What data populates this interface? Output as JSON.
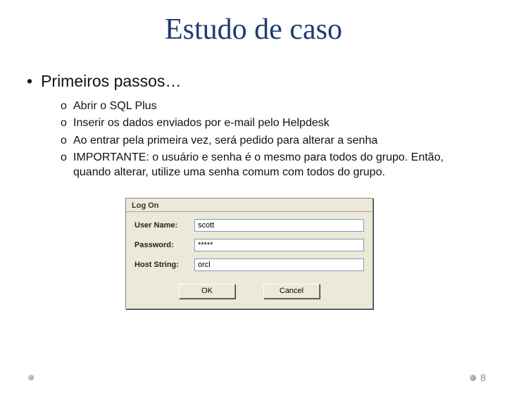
{
  "title": "Estudo de caso",
  "heading": "Primeiros passos…",
  "items": [
    "Abrir o SQL Plus",
    "Inserir os dados enviados por e-mail pelo Helpdesk",
    "Ao entrar pela primeira vez, será pedido para alterar a senha",
    "IMPORTANTE: o usuário e senha é o mesmo para todos do grupo. Então, quando alterar, utilize uma senha comum com todos do grupo."
  ],
  "dialog": {
    "title": "Log On",
    "username_label": "User Name:",
    "username_value": "scott",
    "password_label": "Password:",
    "password_value": "*****",
    "host_label": "Host String:",
    "host_value": "orcl",
    "ok_label": "OK",
    "cancel_label": "Cancel"
  },
  "page_number": "8"
}
